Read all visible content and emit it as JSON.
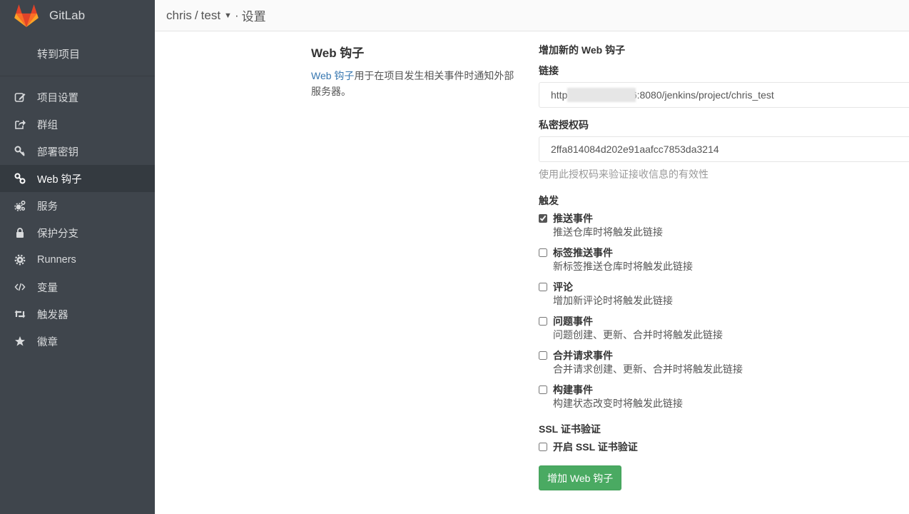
{
  "brand": {
    "name": "GitLab",
    "logo_colors": [
      "#e24329",
      "#fc6d26",
      "#fca326"
    ]
  },
  "sidebar": {
    "goto_project": "转到项目",
    "items": [
      {
        "label": "项目设置",
        "icon": "edit-icon",
        "active": false
      },
      {
        "label": "群组",
        "icon": "share-icon",
        "active": false
      },
      {
        "label": "部署密钥",
        "icon": "key-icon",
        "active": false
      },
      {
        "label": "Web 钩子",
        "icon": "link-icon",
        "active": true
      },
      {
        "label": "服务",
        "icon": "cogs-icon",
        "active": false
      },
      {
        "label": "保护分支",
        "icon": "lock-icon",
        "active": false
      },
      {
        "label": "Runners",
        "icon": "gear-icon",
        "active": false
      },
      {
        "label": "变量",
        "icon": "code-icon",
        "active": false
      },
      {
        "label": "触发器",
        "icon": "retweet-icon",
        "active": false
      },
      {
        "label": "徽章",
        "icon": "star-icon",
        "active": false
      }
    ]
  },
  "header": {
    "namespace": "chris",
    "project": "test",
    "page": "设置"
  },
  "info": {
    "title": "Web 钩子",
    "desc_link": "Web 钩子",
    "desc_rest": "用于在项目发生相关事件时通知外部服务器。"
  },
  "form": {
    "title": "增加新的 Web 钩子",
    "url_label": "链接",
    "url_value": "http                       6:8080/jenkins/project/chris_test",
    "token_label": "私密授权码",
    "token_value": "2ffa814084d202e91aafcc7853da3214",
    "token_help": "使用此授权码来验证接收信息的有效性",
    "trigger_label": "触发",
    "triggers": [
      {
        "title": "推送事件",
        "desc": "推送仓库时将触发此链接",
        "checked": true
      },
      {
        "title": "标签推送事件",
        "desc": "新标签推送仓库时将触发此链接",
        "checked": false
      },
      {
        "title": "评论",
        "desc": "增加新评论时将触发此链接",
        "checked": false
      },
      {
        "title": "问题事件",
        "desc": "问题创建、更新、合并时将触发此链接",
        "checked": false
      },
      {
        "title": "合并请求事件",
        "desc": "合并请求创建、更新、合并时将触发此链接",
        "checked": false
      },
      {
        "title": "构建事件",
        "desc": "构建状态改变时将触发此链接",
        "checked": false
      }
    ],
    "ssl_label": "SSL 证书验证",
    "ssl_checkbox": "开启 SSL 证书验证",
    "ssl_checked": false,
    "submit": "增加 Web 钩子"
  },
  "colors": {
    "sidebar_bg": "#3f454c",
    "sidebar_active": "#343a40",
    "link": "#3777b0",
    "button_green": "#4aaa62"
  }
}
